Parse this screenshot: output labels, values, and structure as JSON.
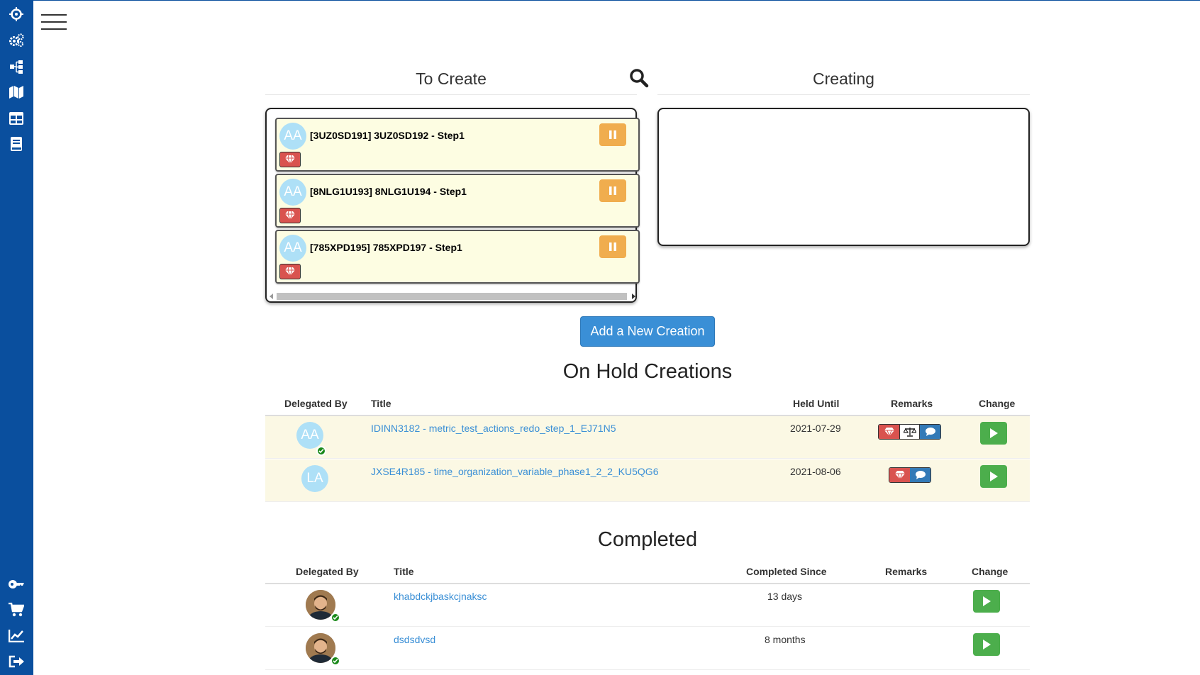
{
  "sidebar": {
    "top_icons": [
      "crosshair-icon",
      "gears-icon",
      "sitemap-icon",
      "map-icon",
      "table-icon",
      "book-icon"
    ],
    "bottom_icons": [
      "key-icon",
      "cart-icon",
      "chart-icon",
      "logout-icon"
    ]
  },
  "header": {
    "menu_icon": "hamburger-icon"
  },
  "board": {
    "to_create_title": "To Create",
    "creating_title": "Creating",
    "cards": [
      {
        "initials": "AA",
        "title": "[3UZ0SD191] 3UZ0SD192 - Step1"
      },
      {
        "initials": "AA",
        "title": "[8NLG1U193] 8NLG1U194 - Step1"
      },
      {
        "initials": "AA",
        "title": "[785XPD195] 785XPD197 - Step1"
      }
    ]
  },
  "add_button": "Add a New Creation",
  "on_hold": {
    "title": "On Hold Creations",
    "headers": [
      "Delegated By",
      "Title",
      "Held Until",
      "Remarks",
      "Change"
    ],
    "rows": [
      {
        "initials": "AA",
        "title": "IDINN3182 - metric_test_actions_redo_step_1_EJ71N5",
        "held_until": "2021-07-29",
        "remarks": [
          "gem-icon",
          "scale-icon",
          "comment-icon"
        ]
      },
      {
        "initials": "LA",
        "title": "JXSE4R185 - time_organization_variable_phase1_2_2_KU5QG6",
        "held_until": "2021-08-06",
        "remarks": [
          "gem-icon",
          "comment-icon"
        ]
      }
    ]
  },
  "completed": {
    "title": "Completed",
    "headers": [
      "Delegated By",
      "Title",
      "Completed Since",
      "Remarks",
      "Change"
    ],
    "rows": [
      {
        "title": "khabdckjbaskcjnaksc",
        "since": "13 days"
      },
      {
        "title": "dsdsdvsd",
        "since": "8 months"
      }
    ]
  },
  "colors": {
    "sidebar": "#0a4f9e",
    "card_bg": "#fdfde2",
    "pause": "#f0ad4e",
    "play": "#4cae4c",
    "primary": "#3a8fd6",
    "danger": "#d9534f"
  }
}
